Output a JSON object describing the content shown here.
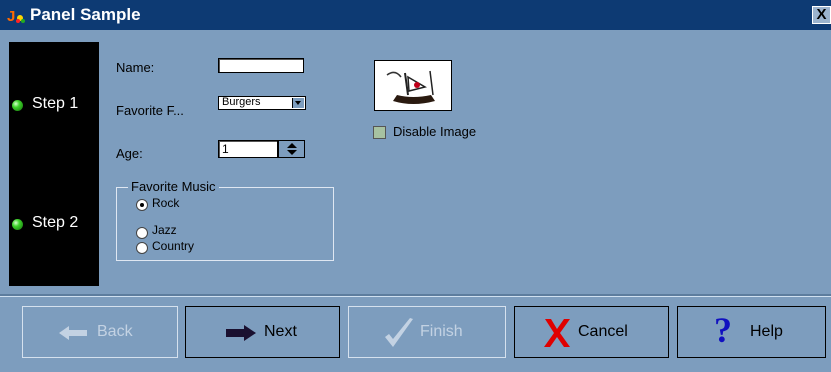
{
  "window": {
    "title": "Panel Sample",
    "close_glyph": "X"
  },
  "steps": [
    {
      "label": "Step 1"
    },
    {
      "label": "Step 2"
    }
  ],
  "form": {
    "name_label": "Name:",
    "name_value": "",
    "food_label": "Favorite F...",
    "food_value": "Burgers",
    "age_label": "Age:",
    "age_value": "1"
  },
  "music": {
    "legend": "Favorite Music",
    "options": [
      {
        "label": "Rock",
        "selected": true
      },
      {
        "label": "Jazz",
        "selected": false
      },
      {
        "label": "Country",
        "selected": false
      }
    ]
  },
  "image": {
    "checkbox_label": "Disable Image",
    "checked": false
  },
  "buttons": {
    "back": "Back",
    "next": "Next",
    "finish": "Finish",
    "cancel": "Cancel",
    "help": "Help"
  },
  "colors": {
    "background": "#7d9dbe",
    "titlebar": "#0d3a73",
    "step_panel": "#000000",
    "step_led": "#3ed32a",
    "cancel_icon": "#e00000",
    "help_icon": "#1010c0"
  }
}
